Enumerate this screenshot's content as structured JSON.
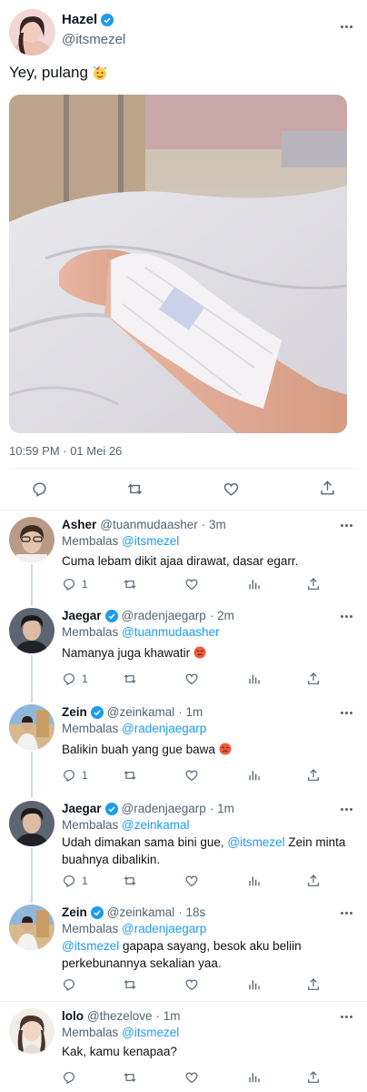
{
  "main": {
    "name": "Hazel",
    "handle": "@itsmezel",
    "text": "Yey, pulang",
    "emoji": "partying-face-emoji",
    "timestamp": "10:59 PM · 01 Mei 26"
  },
  "replies": [
    {
      "name": "Asher",
      "handle": "@tuanmudaasher",
      "time": "· 3m",
      "verified": false,
      "replying_label": "Membalas",
      "replying_to": "@itsmezel",
      "text": "Cuma lebam dikit ajaa dirawat, dasar egarr.",
      "reply_count": "1"
    },
    {
      "name": "Jaegar",
      "handle": "@radenjaegarp",
      "time": "· 2m",
      "verified": true,
      "replying_label": "Membalas",
      "replying_to": "@tuanmudaasher",
      "text": "Namanya juga khawatir",
      "reply_count": "1"
    },
    {
      "name": "Zein",
      "handle": "@zeinkamal",
      "time": "· 1m",
      "verified": true,
      "replying_label": "Membalas",
      "replying_to": "@radenjaegarp",
      "text": "Balikin buah yang gue bawa",
      "reply_count": "1"
    },
    {
      "name": "Jaegar",
      "handle": "@radenjaegarp",
      "time": "· 1m",
      "verified": true,
      "replying_label": "Membalas",
      "replying_to": "@zeinkamal",
      "text_before": "Udah dimakan sama bini gue,",
      "text_mention": "@itsmezel",
      "text_after": "Zein minta buahnya dibalikin.",
      "reply_count": "1"
    },
    {
      "name": "Zein",
      "handle": "@zeinkamal",
      "time": "· 18s",
      "verified": true,
      "replying_label": "Membalas",
      "replying_to": "@radenjaegarp",
      "text_mention": "@itsmezel",
      "text_after": "gapapa sayang, besok aku beliin perkebunannya sekalian yaa.",
      "reply_count": ""
    },
    {
      "name": "lolo",
      "handle": "@thezelove",
      "time": "· 1m",
      "verified": false,
      "replying_label": "Membalas",
      "replying_to": "@itsmezel",
      "text": "Kak, kamu kenapaa?",
      "reply_count": ""
    }
  ],
  "icons": {
    "reply": "reply-icon",
    "retweet": "retweet-icon",
    "like": "heart-icon",
    "analytics": "analytics-icon",
    "share": "share-icon",
    "more": "more-icon"
  },
  "colors": {
    "accent": "#1d9bf0",
    "secondary": "#536471"
  }
}
